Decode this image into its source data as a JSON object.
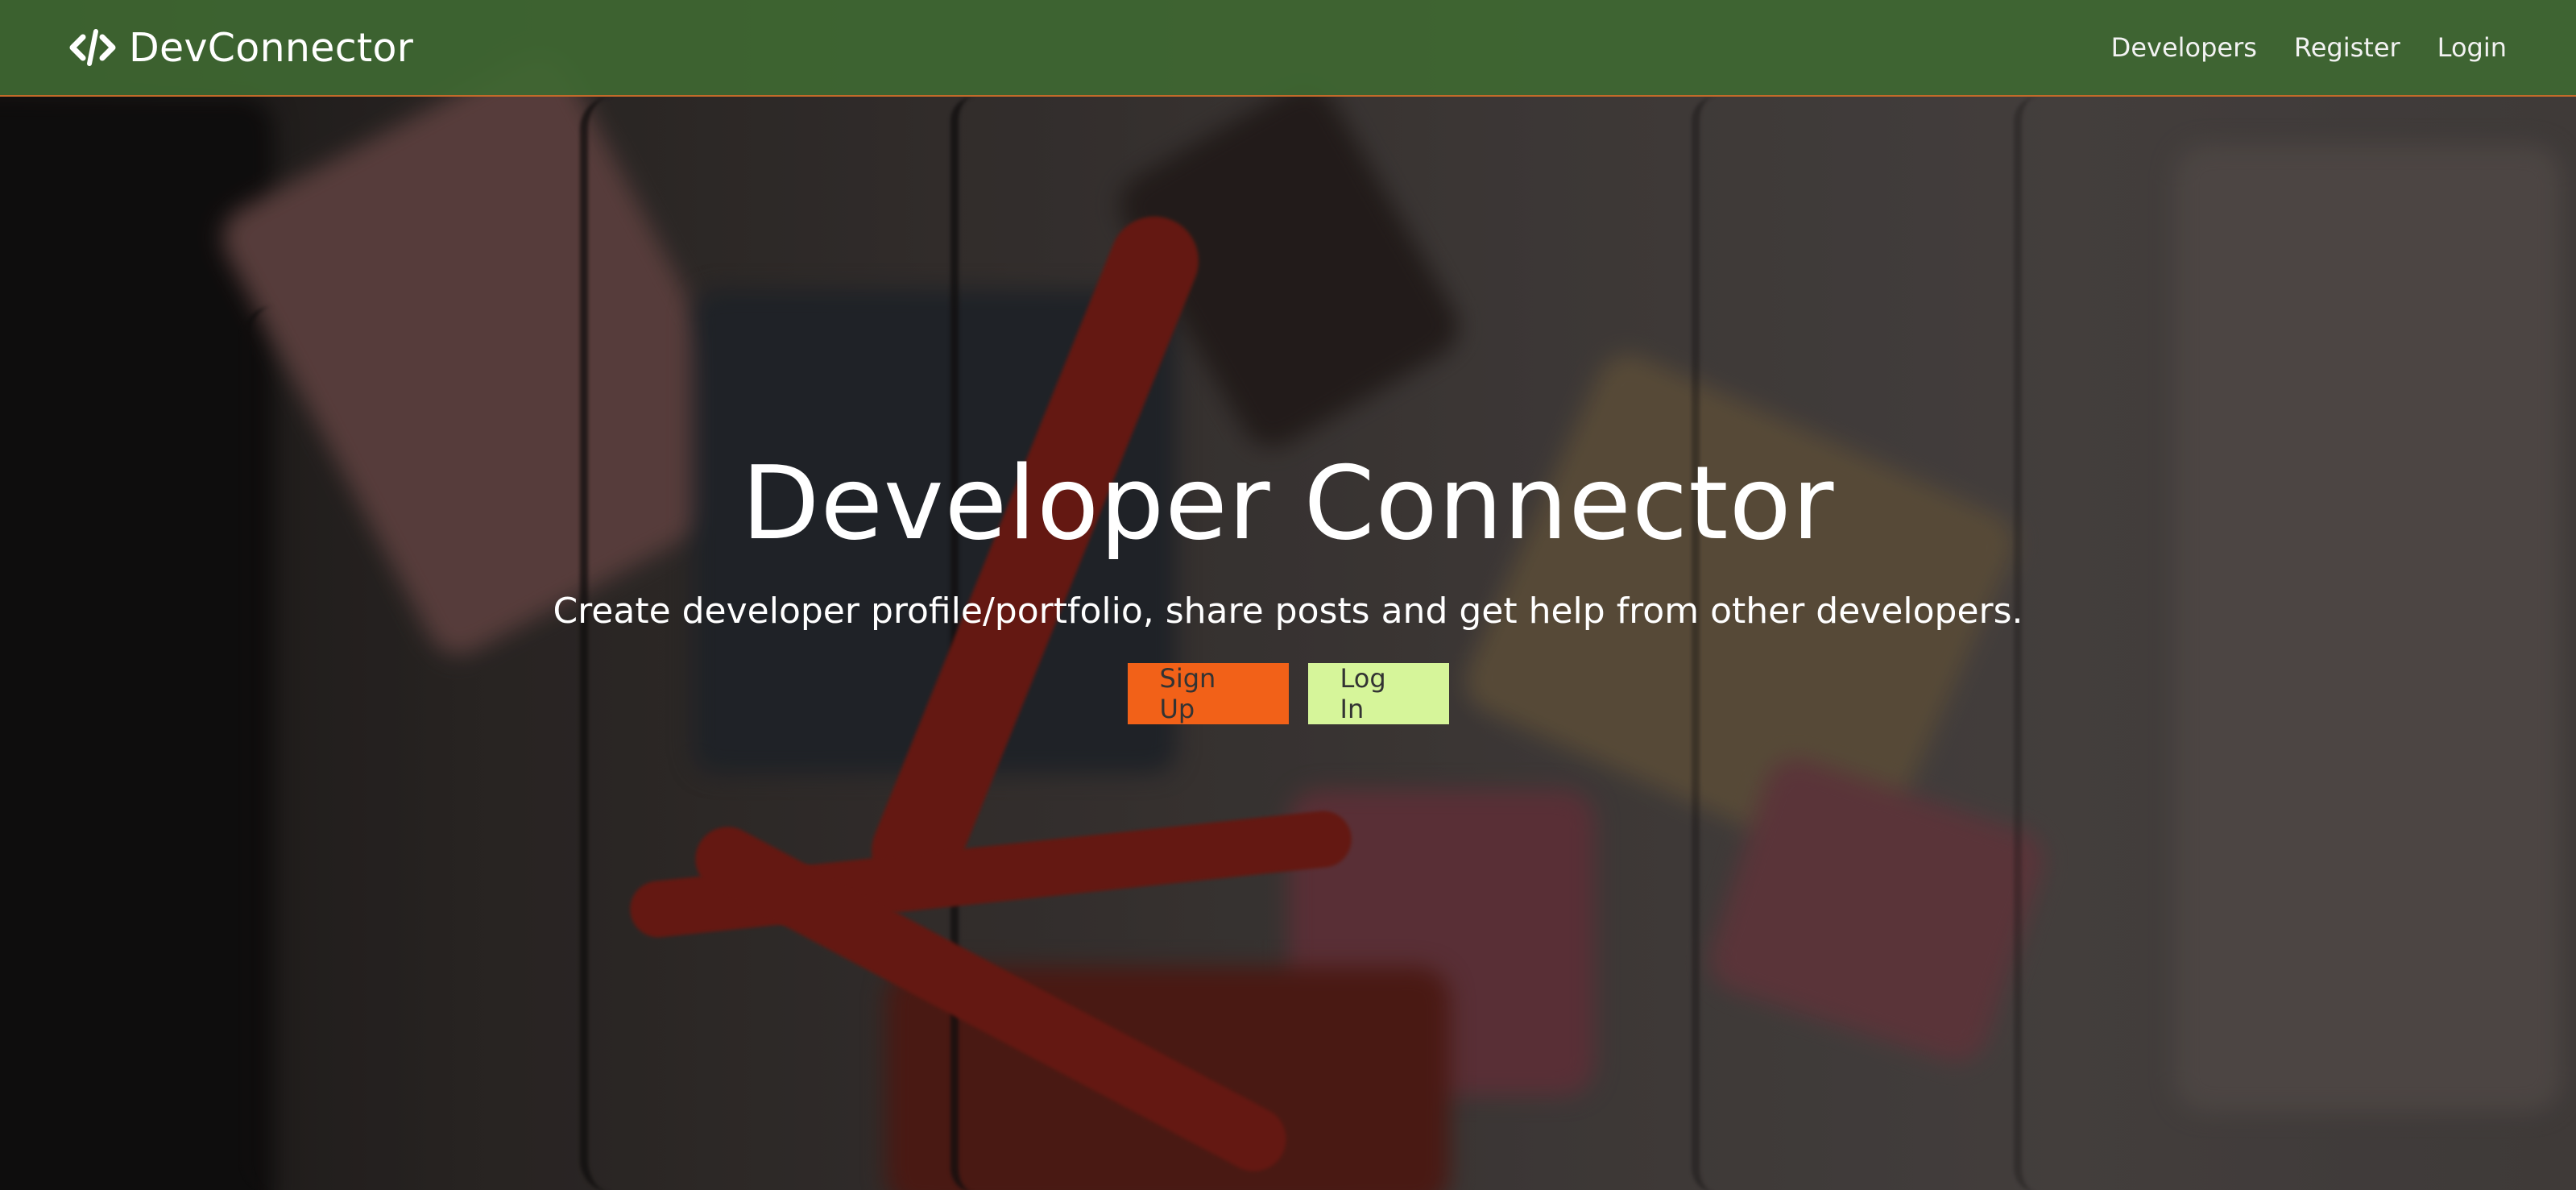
{
  "brand": {
    "name": "DevConnector",
    "icon": "code-icon"
  },
  "nav": {
    "links": [
      {
        "label": "Developers"
      },
      {
        "label": "Register"
      },
      {
        "label": "Login"
      }
    ]
  },
  "hero": {
    "title": "Developer Connector",
    "lead": "Create developer profile/portfolio, share posts and get help from other developers.",
    "signup_label": "Sign Up",
    "login_label": "Log In"
  },
  "colors": {
    "navbar": "#3e6732",
    "navbar_border": "#c26a2a",
    "signup_bg": "#f26118",
    "login_bg": "#d6f59a",
    "button_text": "#333333",
    "text": "#ffffff"
  }
}
